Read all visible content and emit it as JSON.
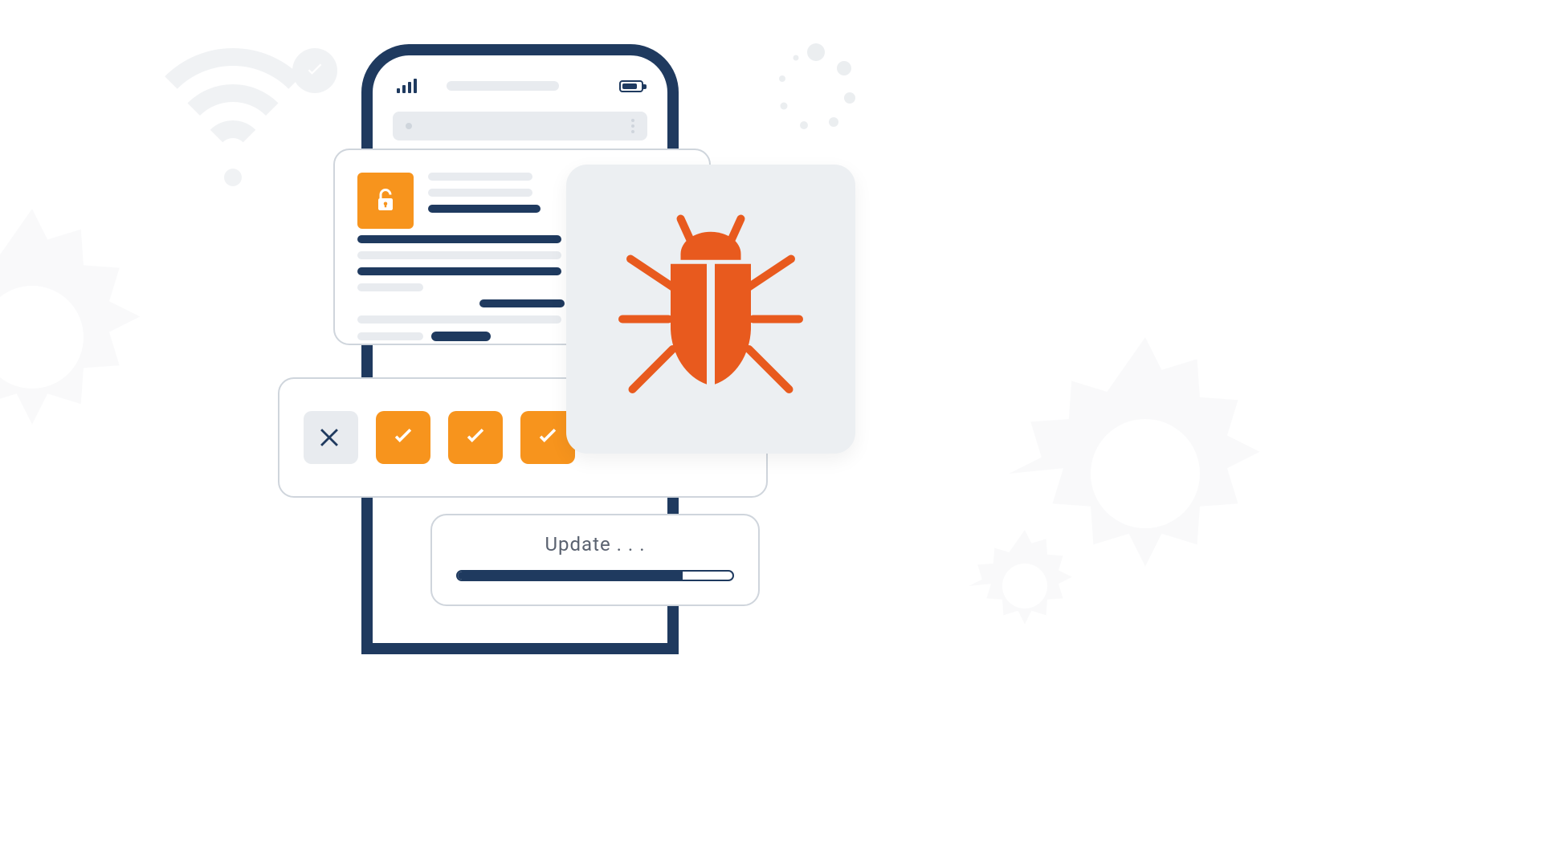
{
  "colors": {
    "dark_blue": "#1f3a5f",
    "orange": "#f7941d",
    "bug_orange": "#e85a1e",
    "grey_bg": "#e8ebef",
    "border_grey": "#cfd5dc"
  },
  "icons": {
    "wifi_check": "wifi-check-icon",
    "gear_left": "gear-icon",
    "gear_right": "gear-icon",
    "lock": "lock-open-icon",
    "bug": "bug-icon",
    "cross": "close-icon",
    "check": "check-icon",
    "signal": "signal-icon",
    "battery": "battery-icon"
  },
  "checklist": {
    "items": [
      {
        "type": "cross"
      },
      {
        "type": "check"
      },
      {
        "type": "check"
      },
      {
        "type": "check"
      }
    ]
  },
  "update": {
    "label": "Update . . .",
    "progress_percent": 82
  }
}
